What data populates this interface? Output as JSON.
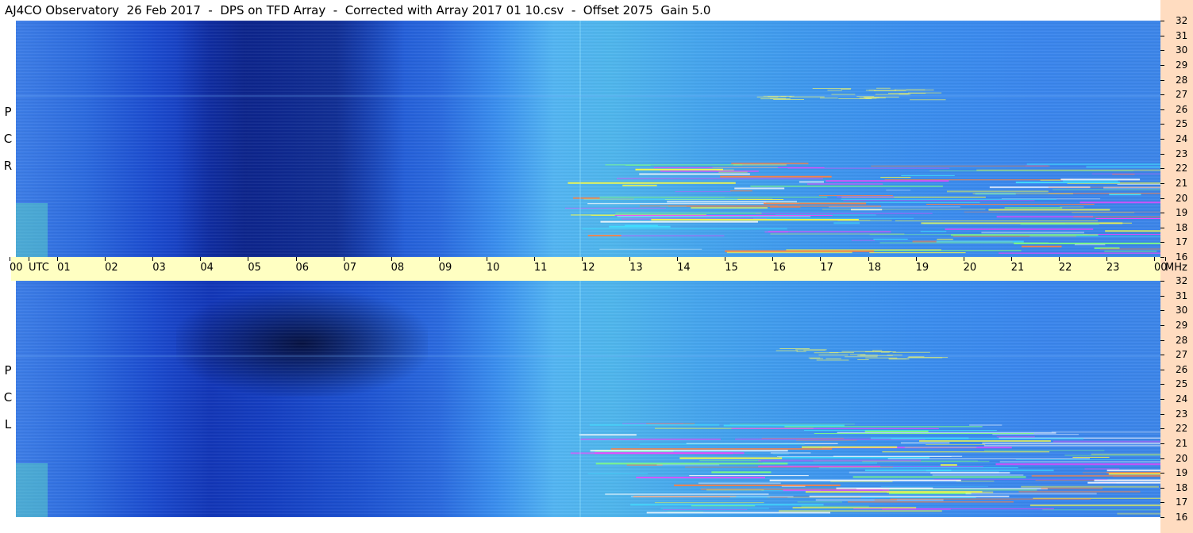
{
  "header": {
    "title": "AJ4CO Observatory  26 Feb 2017  -  DPS on TFD Array  -  Corrected with Array 2017 01 10.csv  -  Offset 2075  Gain 5.0"
  },
  "panels": {
    "rcp": {
      "label": [
        "R",
        "C",
        "P"
      ]
    },
    "lcp": {
      "label": [
        "L",
        "C",
        "P"
      ]
    }
  },
  "chart_data": {
    "type": "heatmap",
    "title": "AJ4CO Observatory  26 Feb 2017  -  DPS on TFD Array  -  Corrected with Array 2017 01 10.csv  -  Offset 2075  Gain 5.0",
    "xlabel": "UTC",
    "ylabel": "MHz",
    "x_ticks": [
      "00",
      "UTC",
      "01",
      "02",
      "03",
      "04",
      "05",
      "06",
      "07",
      "08",
      "09",
      "10",
      "11",
      "12",
      "13",
      "14",
      "15",
      "16",
      "17",
      "18",
      "19",
      "20",
      "21",
      "22",
      "23",
      "00",
      "MHz"
    ],
    "y_ticks": [
      "32",
      "31",
      "30",
      "29",
      "28",
      "27",
      "26",
      "25",
      "24",
      "23",
      "22",
      "21",
      "20",
      "19",
      "18",
      "17",
      "16"
    ],
    "xlim": [
      0,
      24
    ],
    "ylim": [
      16,
      32
    ],
    "panels": [
      "R C P",
      "L C P"
    ],
    "colors": {
      "low": "#050a3c",
      "mid": "#2a6ae0",
      "high": "#7de8a0",
      "peak": "#ff00ff"
    }
  }
}
